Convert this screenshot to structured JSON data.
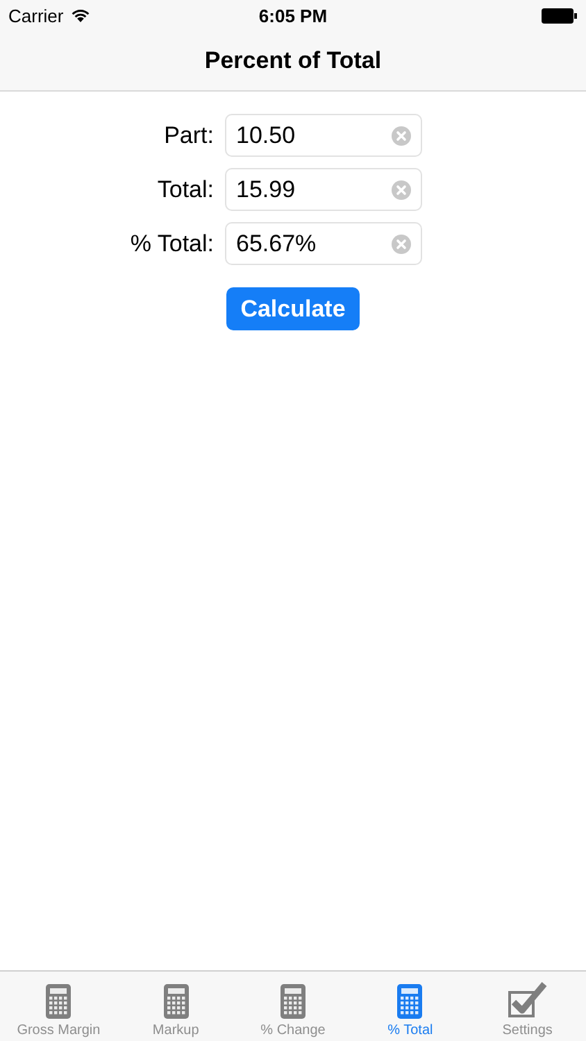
{
  "status_bar": {
    "carrier": "Carrier",
    "time": "6:05 PM"
  },
  "nav_bar": {
    "title": "Percent of Total"
  },
  "fields": [
    {
      "label": "Part:",
      "value": "10.50"
    },
    {
      "label": "Total:",
      "value": "15.99"
    },
    {
      "label": "% Total:",
      "value": "65.67%"
    }
  ],
  "calculate_button": "Calculate",
  "tabs": [
    {
      "label": "Gross Margin",
      "kind": "calculator",
      "selected": false
    },
    {
      "label": "Markup",
      "kind": "calculator",
      "selected": false
    },
    {
      "label": "% Change",
      "kind": "calculator",
      "selected": false
    },
    {
      "label": "% Total",
      "kind": "calculator",
      "selected": true
    },
    {
      "label": "Settings",
      "kind": "checkbox",
      "selected": false
    }
  ]
}
